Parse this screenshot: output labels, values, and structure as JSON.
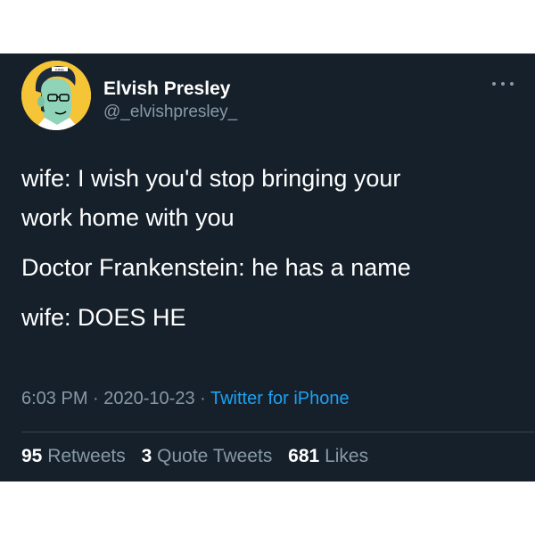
{
  "author": {
    "display_name": "Elvish Presley",
    "handle": "@_elvishpresley_",
    "avatar_icon": "cartoon-elvis-avatar"
  },
  "more_icon": "more-dots-icon",
  "tweet": {
    "lines": [
      "wife: I wish you'd stop bringing your",
      "work home with you",
      "Doctor Frankenstein: he has a name",
      "wife: DOES HE"
    ]
  },
  "meta": {
    "time": "6:03 PM",
    "sep1": " · ",
    "date": "2020-10-23",
    "sep2": " · ",
    "source": "Twitter for iPhone"
  },
  "stats": {
    "retweets_count": "95",
    "retweets_label": "Retweets",
    "quotes_count": "3",
    "quotes_label": "Quote Tweets",
    "likes_count": "681",
    "likes_label": "Likes"
  },
  "colors": {
    "background": "#15202b",
    "text": "#ffffff",
    "secondary": "#8899a6",
    "link": "#1da1f2",
    "avatar_bg": "#f6c437"
  }
}
